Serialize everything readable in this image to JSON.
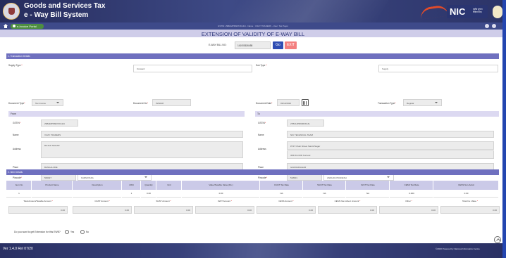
{
  "header": {
    "title_line1": "Goods and Services Tax",
    "title_line2": "e - Way Bill System",
    "nic_logo_text": "NIC",
    "nic_logo_sub": "राष्ट्रीय सूचना विज्ञान केन्द्र"
  },
  "nav": {
    "portal_label": "e-Invoice Portal",
    "login_info": "GSTIN: 29BHMPM9074K1ZH - Name : VIJAY TRADERS - User: Tax Payer"
  },
  "page": {
    "title": "EXTENSION OF VALIDITY OF E-WAY BILL",
    "ewb_label": "E-WAY BILL NO:",
    "ewb_value": "141003626458",
    "go_label": "Go",
    "exit_label": "EXIT"
  },
  "transaction": {
    "section_label": "1. Transaction Details",
    "supply_type_label": "Supply Type",
    "supply_type_value": "Outward",
    "sub_type_label": "Sub Type",
    "sub_type_value": "Supply",
    "doc_type_label": "Document Type",
    "doc_type_value": "Tax Invoice",
    "doc_no_label": "Document No",
    "doc_no_value": "ININ108",
    "doc_date_label": "Document Date",
    "doc_date_value": "03/12/2020",
    "txn_type_label": "Transaction Type",
    "txn_type_value": "Regular"
  },
  "from": {
    "header": "From",
    "gstin_label": "GSTIN",
    "gstin_value": "29BHMPM9074K1ZH",
    "name_label": "Name",
    "name_value": "VIJAY TRADERS",
    "address_label": "Address",
    "address_value": "RAJAJI NAGAR",
    "place_label": "Place",
    "place_value": "BANGALORE",
    "pincode_label": "Pincode",
    "pincode_value": "560027",
    "state_value": "KARNATAKA"
  },
  "to": {
    "header": "To",
    "gstin_label": "GSTIN",
    "gstin_value": "27BCHPM9963K1ZL",
    "name_label": "Name",
    "name_value": "NIC TECHNICAL TEAM",
    "address_label": "Address",
    "address_line1": "#747 Chain Street Sainik Nagar",
    "address_line2": "3RD FLOOR Kurnool",
    "place_label": "Place",
    "place_value": "GANDHINAGAR",
    "pincode_label": "Pincode",
    "pincode_value": "518001",
    "state_value": "ANDHRA PRADESH"
  },
  "items": {
    "section_label": "2. Item Details",
    "columns": [
      "Item No",
      "Product Name",
      "Description",
      "HSN",
      "Quantity",
      "Unit",
      "Value/Taxable Value (Rs.)",
      "CGST Tax Rate",
      "SGST Tax Rate",
      "IGST Tax Rate",
      "CESS Tax Rate",
      "CESS Non.Advol"
    ],
    "row": [
      "1",
      "",
      "",
      "1",
      "0.00",
      "",
      "0.00",
      "NA",
      "NA",
      "NA",
      "0.000",
      "0.00"
    ]
  },
  "totals": {
    "labels": [
      "Total Amount/Taxable Amount",
      "CGST Amount",
      "SGST Amount",
      "IGST Amount",
      "CESS Amount",
      "CESS Non.Advol. Amount",
      "Other",
      "Total Inv. Value"
    ],
    "values": [
      "0.00",
      "0.00",
      "0.00",
      "0.00",
      "0.00",
      "0.00",
      "0.00",
      "0.00"
    ]
  },
  "extension": {
    "question": "Do you want to get Extension for this EWB?",
    "yes_label": "Yes",
    "no_label": "No"
  },
  "footer": {
    "version": "Ver 1.4.0 Rel 07/20",
    "copyright": "©2020 Powered by National Informatics Centre"
  },
  "colors": {
    "header_bg": "#2c3468",
    "section_bar": "#6f70bf",
    "go_button": "#2f4db3",
    "exit_button": "#f37f7f",
    "portal_button": "#4d8e41"
  }
}
